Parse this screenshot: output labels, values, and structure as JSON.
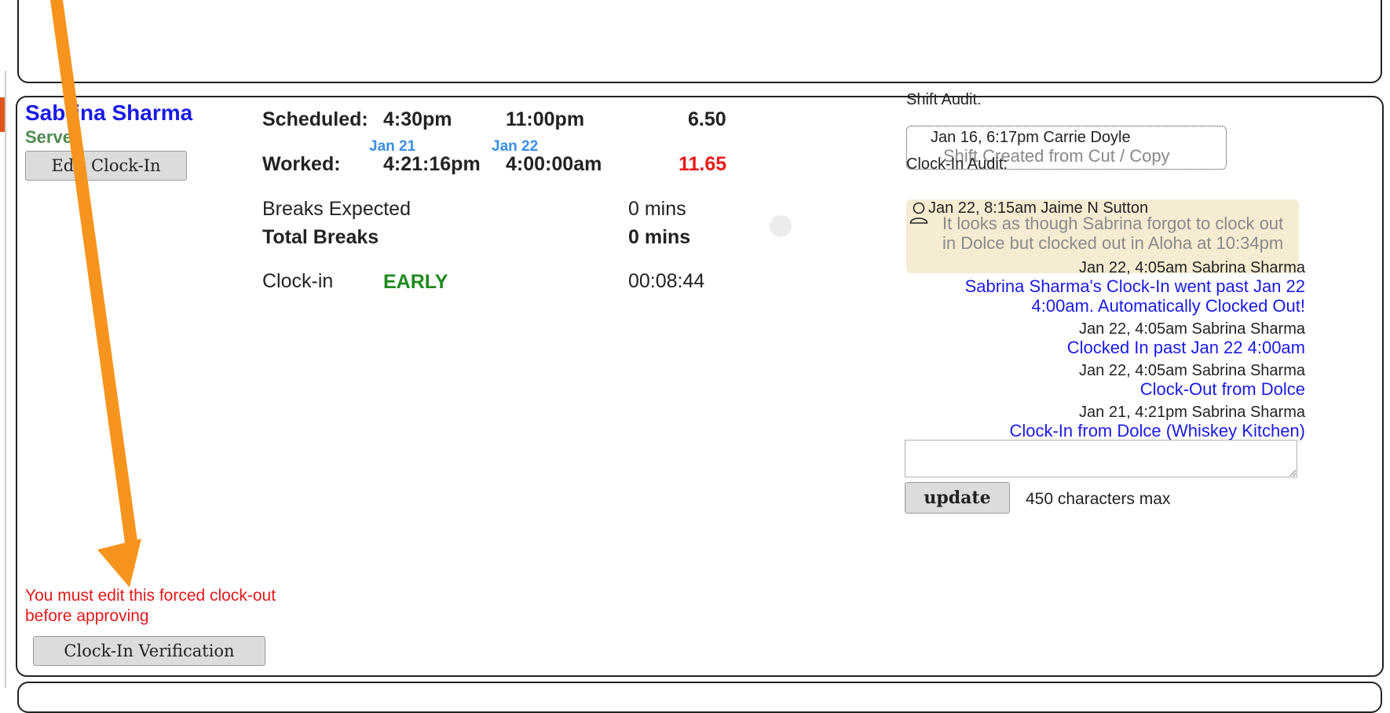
{
  "employee": {
    "name": "Sabrina Sharma",
    "role": "Server",
    "edit_button": "Edit Clock-In",
    "warning": "You must edit this forced clock-out before approving",
    "verify_button": "Clock-In Verification"
  },
  "schedule": {
    "scheduled_label": "Scheduled:",
    "scheduled_start": "4:30pm",
    "scheduled_end": "11:00pm",
    "scheduled_hours": "6.50",
    "worked_label": "Worked:",
    "worked_start_date": "Jan 21",
    "worked_end_date": "Jan 22",
    "worked_start": "4:21:16pm",
    "worked_end": "4:00:00am",
    "worked_hours": "11.65",
    "breaks_expected_label": "Breaks Expected",
    "breaks_expected_value": "0 mins",
    "total_breaks_label": "Total Breaks",
    "total_breaks_value": "0 mins",
    "clockin_label": "Clock-in",
    "clockin_status": "EARLY",
    "clockin_diff": "00:08:44"
  },
  "shift_audit": {
    "heading": "Shift Audit:",
    "meta": "Jan 16, 6:17pm Carrie Doyle",
    "message": "Shift Created from Cut / Copy"
  },
  "clockin_audit": {
    "heading": "Clock-In Audit:",
    "note_meta": "Jan 22, 8:15am Jaime N Sutton",
    "note_body": "It looks as though Sabrina forgot to clock out in Dolce but clocked out in Aloha at 10:34pm",
    "entries": [
      {
        "meta": "Jan 22, 4:05am Sabrina Sharma",
        "message": "Sabrina Sharma's Clock-In went past Jan 22 4:00am. Automatically Clocked Out!"
      },
      {
        "meta": "Jan 22, 4:05am Sabrina Sharma",
        "message": "Clocked In past Jan 22 4:00am"
      },
      {
        "meta": "Jan 22, 4:05am Sabrina Sharma",
        "message": "Clock-Out from Dolce"
      },
      {
        "meta": "Jan 21, 4:21pm Sabrina Sharma",
        "message": "Clock-In from Dolce (Whiskey Kitchen)"
      }
    ],
    "update_button": "update",
    "max_chars": "450 characters max"
  },
  "colors": {
    "name_blue": "#1a1ae6",
    "role_green": "#4f8a4f",
    "warning_red": "#e01a1a",
    "date_blue": "#3a8ee6",
    "early_green": "#1e8a1e",
    "note_bg": "#f6ecd2",
    "annotation_arrow": "#f7941d"
  }
}
